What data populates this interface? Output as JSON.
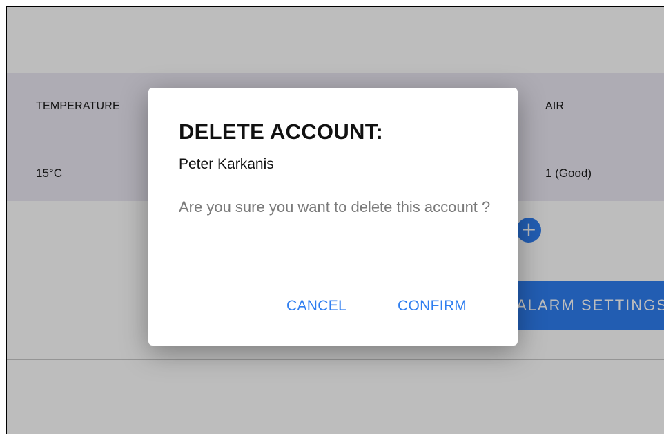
{
  "table": {
    "headers": {
      "temperature": "TEMPERATURE",
      "air": "AIR"
    },
    "row": {
      "temperature": "15°C",
      "air": "1 (Good)"
    }
  },
  "add_button": {
    "label": "+"
  },
  "settings_button": {
    "label": "ALARM SETTINGS"
  },
  "dialog": {
    "title": "DELETE ACCOUNT:",
    "subtitle": "Peter Karkanis",
    "message": "Are you sure you want to delete this account ?",
    "cancel_label": "CANCEL",
    "confirm_label": "CONFIRM"
  },
  "colors": {
    "accent": "#2f7ef0",
    "table_background": "#ebe9f3"
  }
}
